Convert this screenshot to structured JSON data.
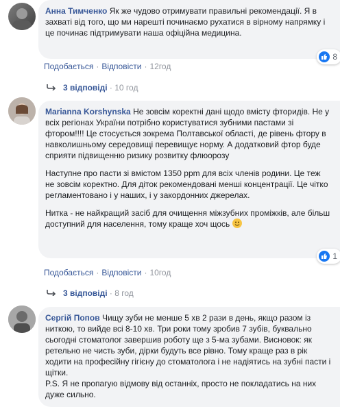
{
  "comments": [
    {
      "author": "Анна Тимченко",
      "text": "Як же чудово отримувати правильні рекомендації. Я в захваті від того, що ми нарешті починаємо рухатися в вірному напрямку і це починає підтримувати наша офіційна медицина.",
      "reaction_count": "8",
      "like_label": "Подобається",
      "reply_label": "Відповісти",
      "time": "12год",
      "replies_label": "3 відповіді",
      "replies_time": "10 год"
    },
    {
      "author": "Marianna Korshynska",
      "paragraphs": [
        "Не зовсім коректні дані щодо вмісту фторидів. Не у всіх регіонах України потрібно користуватися зубними пастами зі фтором!!!! Це стосується зокрема Полтавської області, де рівень фтору в навколишньому середовищі перевищує норму. А додатковий фтор буде сприяти підвищенню ризику розвитку флюорозу",
        "Наступне про пасти зі вмістом 1350 ppm для всіх членів родини. Це теж не зовсім коректно. Для діток рекомендовані менші концентрації. Це чітко регламентовано і у наших, і у закордонних джерелах.",
        "Нитка - не найкращий засіб для очищення міжзубних проміжків, але більш доступний для населення, тому краще хоч щось"
      ],
      "reaction_count": "1",
      "like_label": "Подобається",
      "reply_label": "Відповісти",
      "time": "10год",
      "replies_label": "3 відповіді",
      "replies_time": "8 год"
    },
    {
      "author": "Сергій Попов",
      "text": "Чищу зуби не менше 5 хв 2 рази в день, якщо разом із ниткою, то вийде всі 8-10 хв. Три роки тому зробив 7 зубів, буквально сьогодні стоматолог завершив роботу ще з 5-ма зубами. Висновок: як ретельно не чисть зуби, дірки будуть все рівно. Тому краще раз в рік ходити на професійну гігієну до стоматолога і не надіятись на зубні пасти і щітки.",
      "ps": "P.S. Я не пропагую відмову від останніх, просто не покладатись на них дуже сильно."
    }
  ],
  "colors": {
    "link": "#385898",
    "bubble": "#f2f3f5",
    "meta": "#90949c",
    "like": "#1877f2"
  }
}
